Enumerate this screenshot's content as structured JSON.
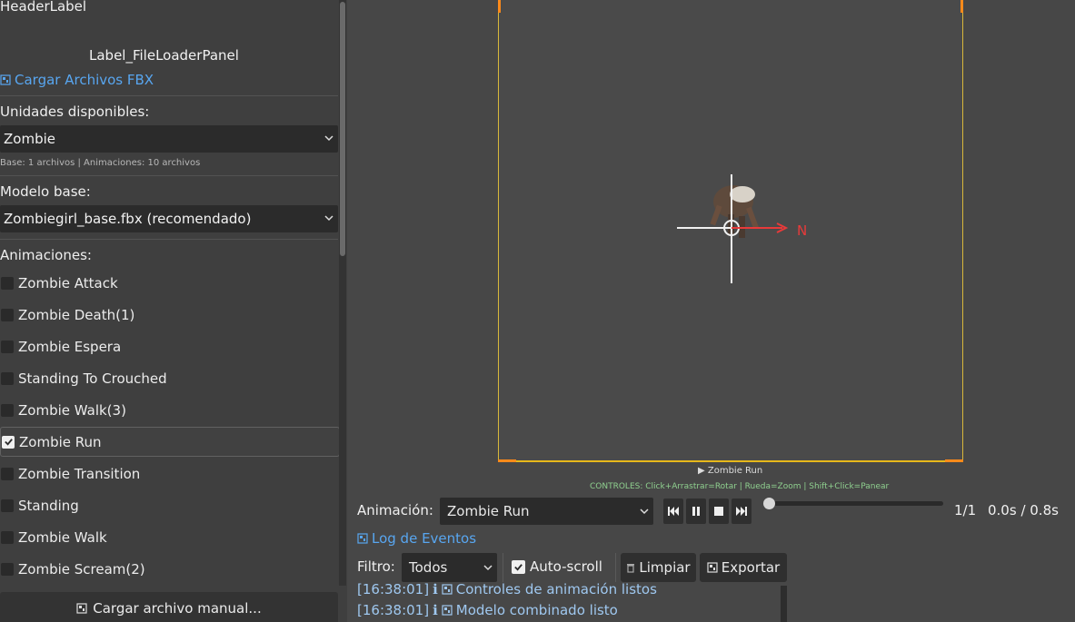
{
  "left_panel": {
    "header_label": "HeaderLabel",
    "loader_label": "Label_FileLoaderPanel",
    "load_fbx_link": "Cargar Archivos FBX",
    "units_label": "Unidades disponibles:",
    "units_selected": "Zombie",
    "units_hint": "Base: 1 archivos | Animaciones: 10 archivos",
    "base_model_label": "Modelo base:",
    "base_model_selected": "Zombiegirl_base.fbx (recomendado)",
    "animations_label": "Animaciones:",
    "animations": [
      {
        "label": "Zombie Attack",
        "checked": false
      },
      {
        "label": "Zombie Death(1)",
        "checked": false
      },
      {
        "label": "Zombie Espera",
        "checked": false
      },
      {
        "label": "Standing To Crouched",
        "checked": false
      },
      {
        "label": "Zombie Walk(3)",
        "checked": false
      },
      {
        "label": "Zombie Run",
        "checked": true
      },
      {
        "label": "Zombie Transition",
        "checked": false
      },
      {
        "label": "Standing",
        "checked": false
      },
      {
        "label": "Zombie Walk",
        "checked": false
      },
      {
        "label": "Zombie Scream(2)",
        "checked": false
      }
    ],
    "manual_load_button": "Cargar archivo manual..."
  },
  "viewport": {
    "north_label": "N",
    "current_anim_caption": "▶ Zombie Run",
    "controls_hint": "CONTROLES: Click+Arrastrar=Rotar | Rueda=Zoom | Shift+Click=Panear"
  },
  "anim_controls": {
    "label": "Animación:",
    "selected": "Zombie Run",
    "progress_fraction": 0.0,
    "counter": "1/1",
    "time": "0.0s / 0.8s"
  },
  "log": {
    "title": "Log de Eventos",
    "filter_label": "Filtro:",
    "filter_selected": "Todos",
    "autoscroll_label": "Auto-scroll",
    "autoscroll_checked": true,
    "clear_button": "Limpiar",
    "export_button": "Exportar",
    "entries": [
      {
        "time": "[16:38:01]",
        "level": "ℹ",
        "text": "Controles de animación listos"
      },
      {
        "time": "[16:38:01]",
        "level": "ℹ",
        "text": "Modelo combinado listo"
      }
    ]
  },
  "colors": {
    "accent_link": "#58a6f0",
    "viewport_border": "#e6b81a",
    "corner_marker": "#ff8a1a",
    "north_arrow": "#e83a3a",
    "controls_hint": "#8fd08f"
  }
}
